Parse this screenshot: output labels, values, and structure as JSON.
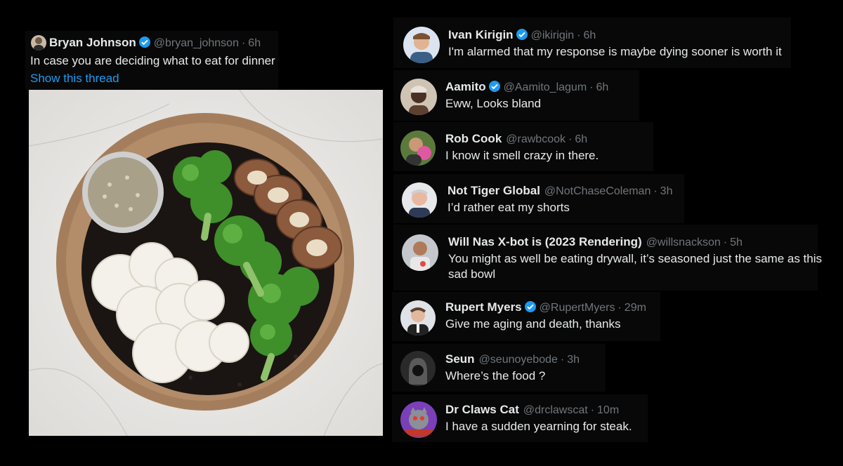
{
  "main_post": {
    "name": "Bryan Johnson",
    "handle": "@bryan_johnson",
    "time": "6h",
    "text": "In case you are deciding what to eat for dinner",
    "show_thread": "Show this thread"
  },
  "replies": [
    {
      "name": "Ivan Kirigin",
      "verified": true,
      "handle": "@ikirigin",
      "time": "6h",
      "text": "I'm alarmed that my response is maybe dying sooner is worth it"
    },
    {
      "name": "Aamito",
      "verified": true,
      "handle": "@Aamito_lagum",
      "time": "6h",
      "text": "Eww, Looks bland"
    },
    {
      "name": "Rob Cook",
      "verified": false,
      "handle": "@rawbcook",
      "time": "6h",
      "text": "I know it smell crazy in there."
    },
    {
      "name": "Not Tiger Global",
      "verified": false,
      "handle": "@NotChaseColeman",
      "time": "3h",
      "text": "I’d rather eat my shorts"
    },
    {
      "name": "Will Nas X-bot is (2023 Rendering)",
      "verified": false,
      "handle": "@willsnackson",
      "time": "5h",
      "text": "You might as well be eating drywall, it’s seasoned just the same as this",
      "text2": "sad bowl"
    },
    {
      "name": "Rupert Myers",
      "verified": true,
      "handle": "@RupertMyers",
      "time": "29m",
      "text": "Give me aging and death, thanks"
    },
    {
      "name": "Seun",
      "verified": false,
      "handle": "@seunoyebode",
      "time": "3h",
      "text": "Where’s the food ?"
    },
    {
      "name": "Dr Claws Cat",
      "verified": false,
      "handle": "@drclawscat",
      "time": "10m",
      "text": "I have a sudden yearning for steak."
    }
  ],
  "separator": "·",
  "colors": {
    "verified": "#1d9bf0",
    "handle": "#71767b",
    "link": "#1d9bf0"
  }
}
